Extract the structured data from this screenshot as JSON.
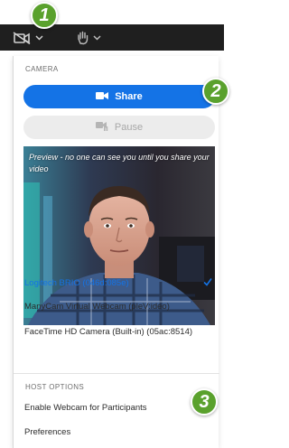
{
  "toolbar": {
    "camera_icon": "camera-off-icon",
    "hand_icon": "raise-hand-icon",
    "dark_color": "#1f1f1f"
  },
  "callouts": [
    "1",
    "2",
    "3"
  ],
  "panel": {
    "camera_label": "CAMERA",
    "share_label": "Share",
    "pause_label": "Pause",
    "preview_text": "Preview - no one can see you until you share your video",
    "devices": [
      {
        "label": "Logitech BRIO (046d:085e)",
        "selected": true
      },
      {
        "label": "ManyCam Virtual Webcam (pleV:ideo)",
        "selected": false
      },
      {
        "label": "FaceTime HD Camera (Built-in) (05ac:8514)",
        "selected": false
      }
    ],
    "host_options_label": "HOST OPTIONS",
    "host_options": [
      "Enable Webcam for Participants",
      "Preferences"
    ]
  },
  "colors": {
    "accent": "#1473e6",
    "badge": "#5aa12d"
  }
}
